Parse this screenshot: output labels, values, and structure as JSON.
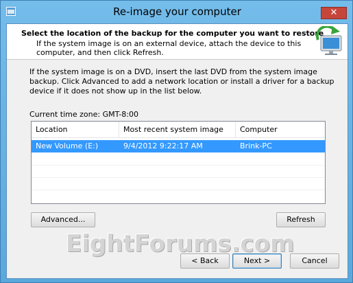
{
  "window": {
    "title": "Re-image your computer",
    "close_glyph": "✕"
  },
  "header": {
    "title": "Select the location of the backup for the computer you want to restore",
    "subtitle": "If the system image is on an external device, attach the device to this computer, and then click Refresh."
  },
  "body": {
    "instructions": "If the system image is on a DVD, insert the last DVD from the system image backup. Click Advanced to add a network location or install a driver for a backup device if it does not show up in the list below.",
    "timezone": "Current time zone: GMT-8:00"
  },
  "list": {
    "columns": [
      "Location",
      "Most recent system image",
      "Computer"
    ],
    "rows": [
      {
        "location": "New Volume (E:)",
        "date": "9/4/2012 9:22:17 AM",
        "computer": "Brink-PC",
        "selected": true
      }
    ]
  },
  "buttons": {
    "advanced": "Advanced...",
    "refresh": "Refresh",
    "back": "< Back",
    "next": "Next >",
    "cancel": "Cancel"
  },
  "watermark": "EightForums.com",
  "colors": {
    "selection": "#3399ff",
    "title_bar": "#6fb5e6",
    "close_button": "#c7463b"
  },
  "icons": {
    "system_menu": "window-icon",
    "header": "restore-monitor-icon",
    "close": "close-icon"
  }
}
